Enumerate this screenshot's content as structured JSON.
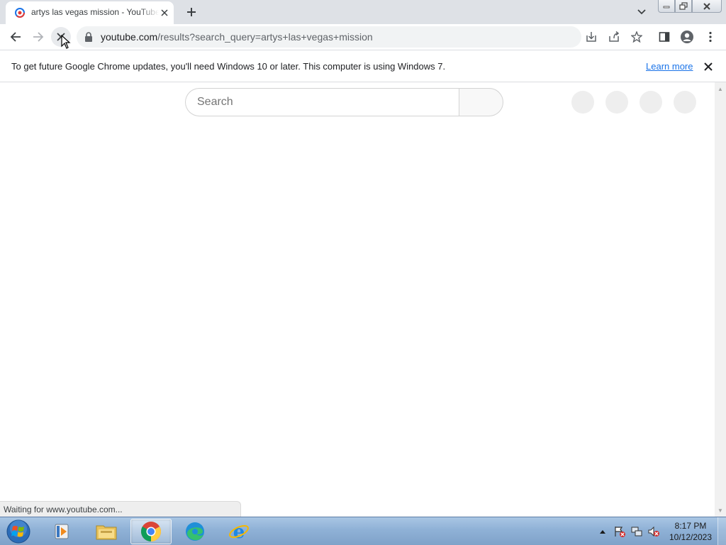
{
  "browser": {
    "tab": {
      "title": "artys las vegas mission - YouTube"
    },
    "omnibox": {
      "url_host": "youtube.com",
      "url_path": "/results?search_query=artys+las+vegas+mission"
    },
    "infobar": {
      "message": "To get future Google Chrome updates, you'll need Windows 10 or later. This computer is using Windows 7.",
      "learn_more": "Learn more"
    },
    "status": "Waiting for www.youtube.com..."
  },
  "page": {
    "search": {
      "placeholder": "Search"
    }
  },
  "taskbar": {
    "pinned": [
      "windows-media-player",
      "windows-explorer",
      "google-chrome",
      "microsoft-edge",
      "internet-explorer"
    ],
    "active": "google-chrome",
    "clock": {
      "time": "8:17 PM",
      "date": "10/12/2023"
    }
  },
  "colors": {
    "tabstrip": "#dee1e6",
    "link": "#1a73e8",
    "taskbar": "#8fb1d6"
  }
}
